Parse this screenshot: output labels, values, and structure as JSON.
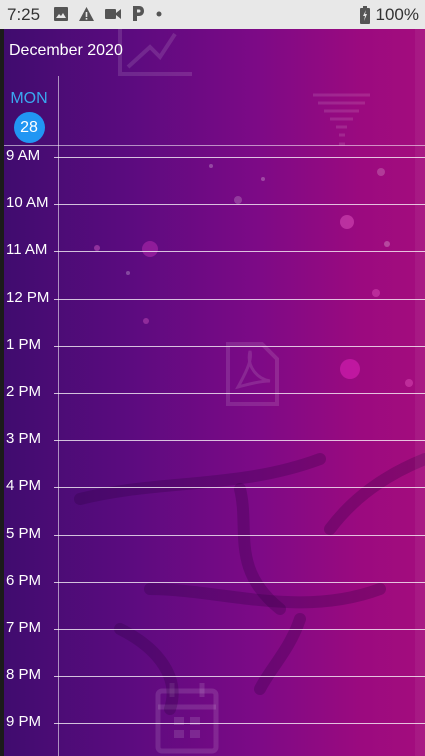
{
  "status_bar": {
    "time": "7:25",
    "battery": "100%",
    "icons_left": [
      "image-icon",
      "warning-icon",
      "video-icon",
      "parking-icon",
      "dot-icon"
    ],
    "icons_right": [
      "battery-icon"
    ]
  },
  "calendar": {
    "month_title": "December 2020",
    "day": {
      "name": "MON",
      "number": "28",
      "accent_color": "#2196f3"
    },
    "hours": [
      "9 AM",
      "10 AM",
      "11 AM",
      "12 PM",
      "1 PM",
      "2 PM",
      "3 PM",
      "4 PM",
      "5 PM",
      "6 PM",
      "7 PM",
      "8 PM",
      "9 PM"
    ]
  },
  "background": {
    "gradient": [
      "#3f0c6e",
      "#a40d7e"
    ],
    "decor_icons": [
      "chart-icon",
      "funnel-icon",
      "pdf-icon",
      "calendar-icon"
    ]
  }
}
